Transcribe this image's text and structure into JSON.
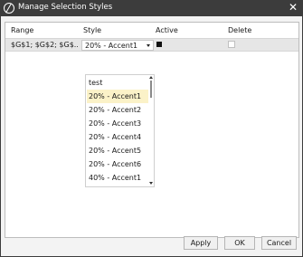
{
  "window": {
    "title": "Manage Selection Styles",
    "close_glyph": "✕"
  },
  "grid": {
    "headers": {
      "range": "Range",
      "style": "Style",
      "active": "Active",
      "delete": "Delete"
    },
    "row": {
      "range": "$G$1; $G$2; $G$...",
      "style": "20% - Accent1",
      "active": true,
      "delete": false
    }
  },
  "dropdown": {
    "options": [
      "test",
      "20% - Accent1",
      "20% - Accent2",
      "20% - Accent3",
      "20% - Accent4",
      "20% - Accent5",
      "20% - Accent6",
      "40% - Accent1"
    ],
    "selected": "20% - Accent1"
  },
  "buttons": {
    "apply": "Apply",
    "ok": "OK",
    "cancel": "Cancel"
  }
}
